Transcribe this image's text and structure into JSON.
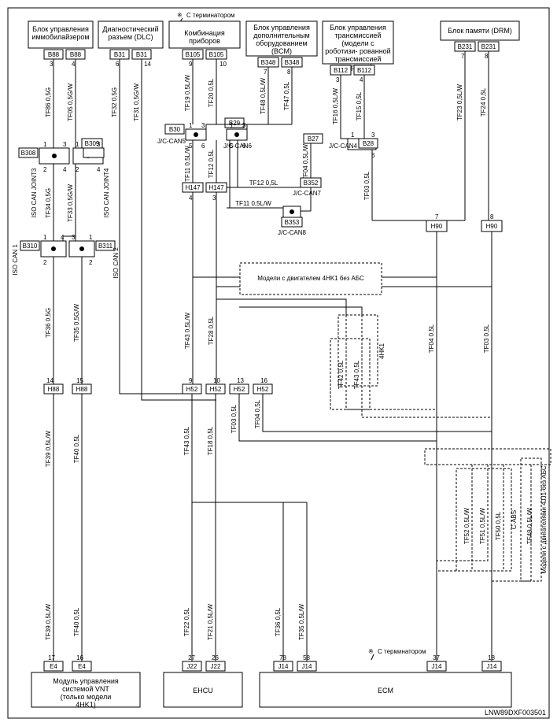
{
  "header_note_left": "С терминатором",
  "footer_note": "С терминатором",
  "footer_id": "LNW89DXF003501",
  "top_boxes": [
    "Блок управления иммобилайзером",
    "Диагностический разъем (DLC)",
    "Комбинация приборов",
    "Блок управления дополнительным оборудованием (BCM)",
    "Блок управления трансмиссией (модели с роботизи- рованной трансмиссией передач)",
    "Блок памяти (DRM)"
  ],
  "bottom_boxes": [
    "Модуль управления системой VNT (только модели 4HK1)",
    "EHCU",
    "ECM"
  ],
  "junctions": {
    "iso_joint3": "ISO CAN JOINT3",
    "iso_joint4": "ISO CAN JOINT4",
    "iso_can1": "ISO CAN 1",
    "iso_can2": "ISO CAN 2",
    "jc_can5": "J/C-CAN5",
    "jc_can6": "J/C-CAN6",
    "jc_can4": "J/C-CAN4",
    "jc_can7": "J/C-CAN7",
    "jc_can8": "J/C-CAN8"
  },
  "dashed_notes": {
    "no_abs": "Модели с двигателем 4HK1 без АБС",
    "abs_4hk1": "4HK1",
    "c_abs": "C-ABS",
    "jj1_no_abs": "Модели с двигателями 4JJ1-без АБС"
  },
  "conns": {
    "B88a": "B88",
    "B88b": "B88",
    "B31a": "B31",
    "B31b": "B31",
    "B105a": "B105",
    "B105b": "B105",
    "B348a": "B348",
    "B348b": "B348",
    "B112a": "B112",
    "B112b": "B112",
    "B231a": "B231",
    "B231b": "B231",
    "B30": "B30",
    "B29": "B29",
    "B27": "B27",
    "B28": "B28",
    "B308": "B308",
    "B309": "B309",
    "B310": "B310",
    "B311": "B311",
    "H147a": "H147",
    "H147b": "H147",
    "B352": "B352",
    "B353": "B353",
    "H90a": "H90",
    "H90b": "H90",
    "H88a": "H88",
    "H88b": "H88",
    "H52a": "H52",
    "H52b": "H52",
    "H52c": "H52",
    "H52d": "H52",
    "E4a": "E4",
    "E4b": "E4",
    "J22a": "J22",
    "J22b": "J22",
    "J14a": "J14",
    "J14b": "J14",
    "J14c": "J14",
    "J14d": "J14"
  },
  "wires": {
    "TF86": "TF86  0,5G",
    "TF05": "TF05  0,5G/W",
    "TF32": "TF32  0,5G",
    "TF31": "TF31  0,5G/W",
    "TF19": "TF19  0,5L/W",
    "TF20": "TF20  0,5L",
    "TF48": "TF48  0,5L/W",
    "TF47": "TF47  0,5L",
    "TF16": "TF16  0,5L/W",
    "TF15": "TF15  0,5L",
    "TF23": "TF23  0,5L/W",
    "TF24": "TF24  0,5L",
    "TF34": "TF34  0,5G",
    "TF33": "TF33  0,5G/W",
    "TF36": "TF36  0,5G",
    "TF35": "TF35  0,5G/W",
    "TF39": "TF39  0,5L/W",
    "TF40": "TF40  0,5L",
    "TF43a": "TF43  0,5L/W",
    "TF43b": "TF43  0,5L",
    "TF11_w": "TF11  0,5L/W",
    "TF12_l": "TF12  0,5L",
    "TF11": "TF11  0,5L/W",
    "TF12": "TF12  0,5L",
    "TF04": "TF04  0,5L/W",
    "TF03": "TF03  0,5L",
    "TF28": "TF28  0,5L",
    "TF18": "TF18  0,5L",
    "TF03b": "TF03  0,5L",
    "TF03c": "TF03  0,5L",
    "TF04b": "TF04  0,5L",
    "TF39b": "TF39  0,5L/W",
    "TF04c": "TF04  0,5L",
    "TF42": "TF42  0,5L",
    "TF43c": "TF43  0,5L",
    "TF51": "TF51  0,5L/W",
    "TF52": "TF52  0,5L/W",
    "TF50": "TF50  0,5L",
    "TF49": "TF49  0,5L/W",
    "TF21": "TF21  0,5L/W",
    "TF22": "TF22  0,5L",
    "TF35b": "TF35  0,5L/W",
    "TF36b": "TF36  0,5L"
  },
  "pins": {
    "p1": "1",
    "p2": "2",
    "p3": "3",
    "p4": "4",
    "p5": "5",
    "p6": "6",
    "p7": "7",
    "p8": "8",
    "p9": "9",
    "p10": "10",
    "p13": "13",
    "p14": "14",
    "p15": "15",
    "p16": "16",
    "p17": "17",
    "p18": "18",
    "p26": "26",
    "p27": "27",
    "p37": "37",
    "p58": "58",
    "p78": "78"
  }
}
